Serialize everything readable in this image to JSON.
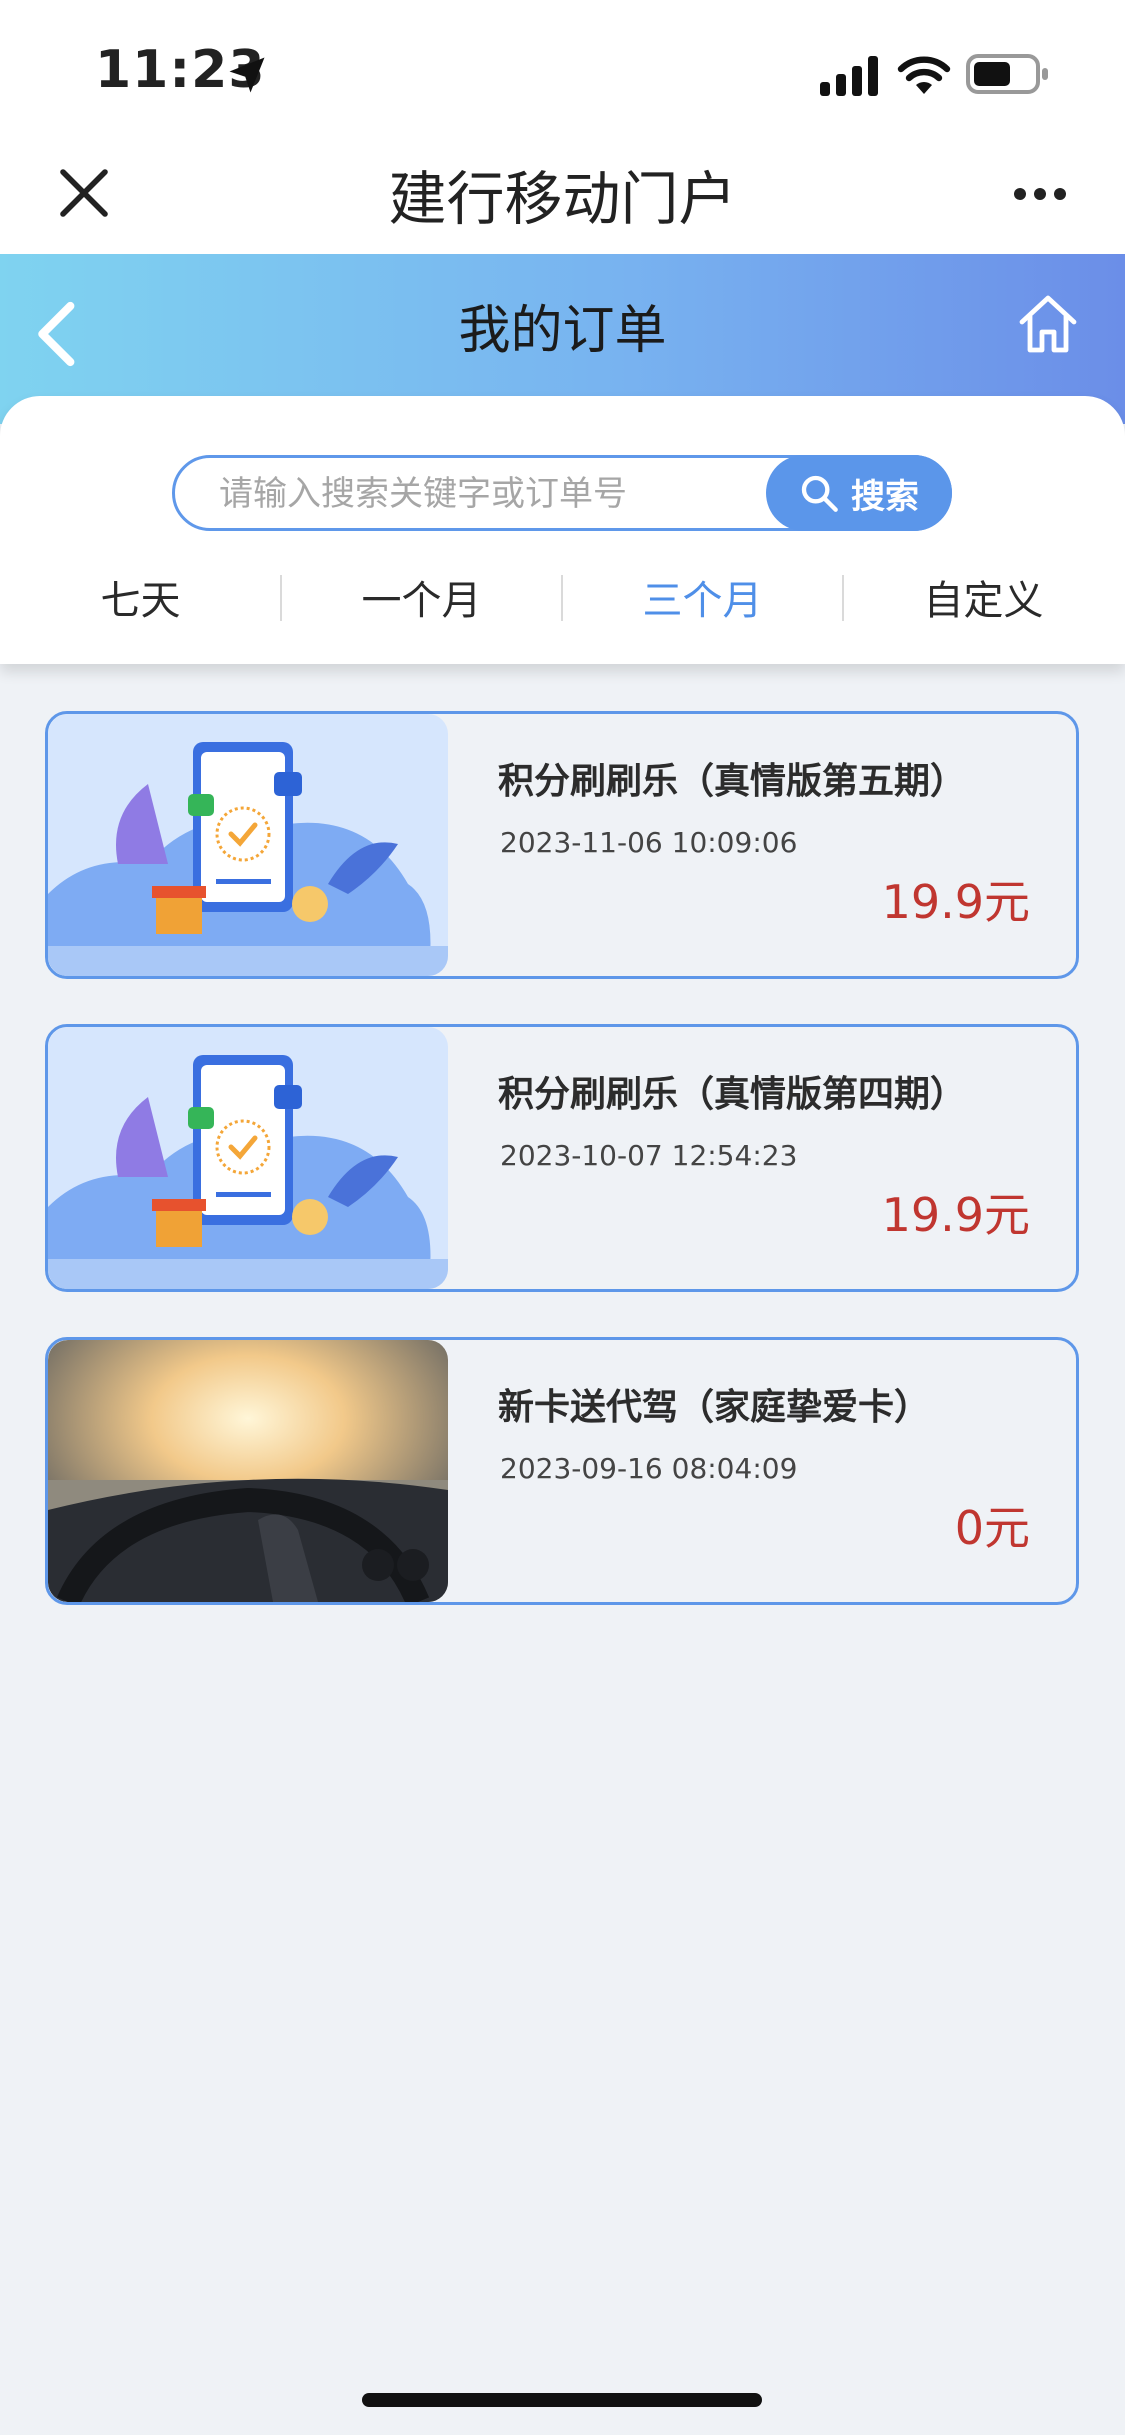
{
  "status_bar": {
    "time": "11:23",
    "icons": [
      "location-arrow-icon",
      "signal-icon",
      "wifi-icon",
      "battery-icon"
    ]
  },
  "nav": {
    "title": "建行移动门户",
    "close_icon": "close-icon",
    "more_icon": "more-icon"
  },
  "header": {
    "title": "我的订单",
    "back_icon": "chevron-left-icon",
    "home_icon": "home-icon"
  },
  "search": {
    "placeholder": "请输入搜索关键字或订单号",
    "value": "",
    "button_label": "搜索"
  },
  "tabs": [
    {
      "label": "七天",
      "active": false
    },
    {
      "label": "一个月",
      "active": false
    },
    {
      "label": "三个月",
      "active": true
    },
    {
      "label": "自定义",
      "active": false
    }
  ],
  "orders": [
    {
      "title": "积分刷刷乐（真情版第五期）",
      "time": "2023-11-06 10:09:06",
      "price": "19.9元",
      "image": "points-phone-illustration"
    },
    {
      "title": "积分刷刷乐（真情版第四期）",
      "time": "2023-10-07 12:54:23",
      "price": "19.9元",
      "image": "points-phone-illustration"
    },
    {
      "title": "新卡送代驾（家庭挚爱卡）",
      "time": "2023-09-16 08:04:09",
      "price": "0元",
      "image": "car-driving-photo"
    }
  ],
  "colors": {
    "accent": "#5b96ea",
    "active_tab": "#4f8fe8",
    "price": "#c03630",
    "header_gradient_start": "#7fd3f0",
    "header_gradient_end": "#6b8ee8"
  }
}
